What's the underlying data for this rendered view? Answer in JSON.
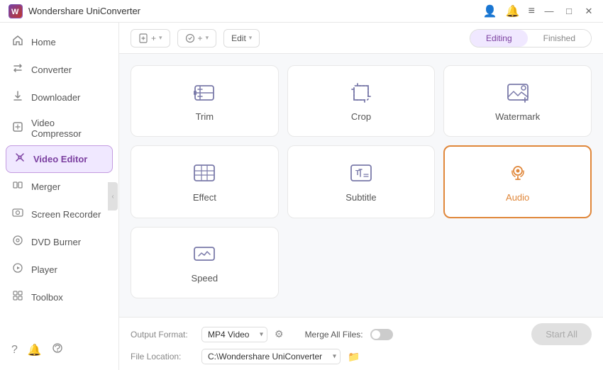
{
  "titleBar": {
    "appName": "Wondershare UniConverter",
    "icons": {
      "user": "👤",
      "bell": "🔔",
      "menu": "≡",
      "minimize": "—",
      "maximize": "□",
      "close": "✕"
    }
  },
  "sidebar": {
    "items": [
      {
        "id": "home",
        "label": "Home",
        "icon": "🏠"
      },
      {
        "id": "converter",
        "label": "Converter",
        "icon": "⇄"
      },
      {
        "id": "downloader",
        "label": "Downloader",
        "icon": "⬇"
      },
      {
        "id": "video-compressor",
        "label": "Video Compressor",
        "icon": "⊡"
      },
      {
        "id": "video-editor",
        "label": "Video Editor",
        "icon": "✂",
        "active": true
      },
      {
        "id": "merger",
        "label": "Merger",
        "icon": "⊞"
      },
      {
        "id": "screen-recorder",
        "label": "Screen Recorder",
        "icon": "⬜"
      },
      {
        "id": "dvd-burner",
        "label": "DVD Burner",
        "icon": "💿"
      },
      {
        "id": "player",
        "label": "Player",
        "icon": "▶"
      },
      {
        "id": "toolbox",
        "label": "Toolbox",
        "icon": "⊞"
      }
    ],
    "bottomIcons": [
      "❓",
      "🔔",
      "◎"
    ]
  },
  "toolbar": {
    "addFileLabel": "+",
    "addScreenLabel": "+",
    "editDropdown": "Edit",
    "tabs": [
      {
        "id": "editing",
        "label": "Editing",
        "active": true
      },
      {
        "id": "finished",
        "label": "Finished",
        "active": false
      }
    ]
  },
  "grid": {
    "cards": [
      {
        "id": "trim",
        "label": "Trim",
        "active": false
      },
      {
        "id": "crop",
        "label": "Crop",
        "active": false
      },
      {
        "id": "watermark",
        "label": "Watermark",
        "active": false
      },
      {
        "id": "effect",
        "label": "Effect",
        "active": false
      },
      {
        "id": "subtitle",
        "label": "Subtitle",
        "active": false
      },
      {
        "id": "audio",
        "label": "Audio",
        "active": true
      },
      {
        "id": "speed",
        "label": "Speed",
        "active": false
      }
    ]
  },
  "bottomBar": {
    "outputFormatLabel": "Output Format:",
    "outputFormat": "MP4 Video",
    "mergeAllFilesLabel": "Merge All Files:",
    "fileLocationLabel": "File Location:",
    "fileLocation": "C:\\Wondershare UniConverter",
    "startAllLabel": "Start All"
  }
}
